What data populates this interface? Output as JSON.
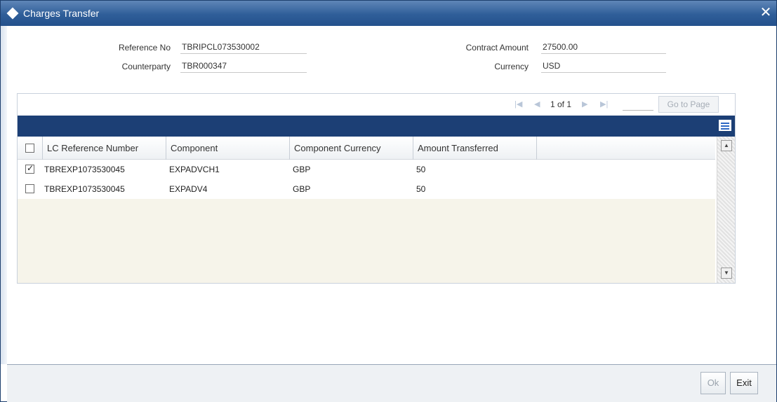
{
  "window": {
    "title": "Charges Transfer",
    "close_glyph": "✕"
  },
  "form": {
    "reference_no": {
      "label": "Reference No",
      "value": "TBRIPCL073530002"
    },
    "counterparty": {
      "label": "Counterparty",
      "value": "TBR000347"
    },
    "contract_amount": {
      "label": "Contract Amount",
      "value": "27500.00"
    },
    "currency": {
      "label": "Currency",
      "value": "USD"
    }
  },
  "pager": {
    "text": "1 of 1",
    "goto_label": "Go to Page",
    "page_input": ""
  },
  "grid": {
    "columns": [
      "LC Reference Number",
      "Component",
      "Component Currency",
      "Amount Transferred"
    ],
    "rows": [
      {
        "checked": true,
        "lc_ref": "TBREXP1073530045",
        "component": "EXPADVCH1",
        "currency": "GBP",
        "amount": "50"
      },
      {
        "checked": false,
        "lc_ref": "TBREXP1073530045",
        "component": "EXPADV4",
        "currency": "GBP",
        "amount": "50"
      }
    ]
  },
  "footer": {
    "ok_label": "Ok",
    "exit_label": "Exit"
  },
  "colors": {
    "title_bar": "#2f5e99",
    "grid_bar": "#1c3f75",
    "row_empty_bg": "#f6f4ea"
  },
  "icons": {
    "first_page": "first-page-icon",
    "prev_page": "prev-page-icon",
    "next_page": "next-page-icon",
    "last_page": "last-page-icon",
    "grid_menu": "grid-menu-icon"
  }
}
